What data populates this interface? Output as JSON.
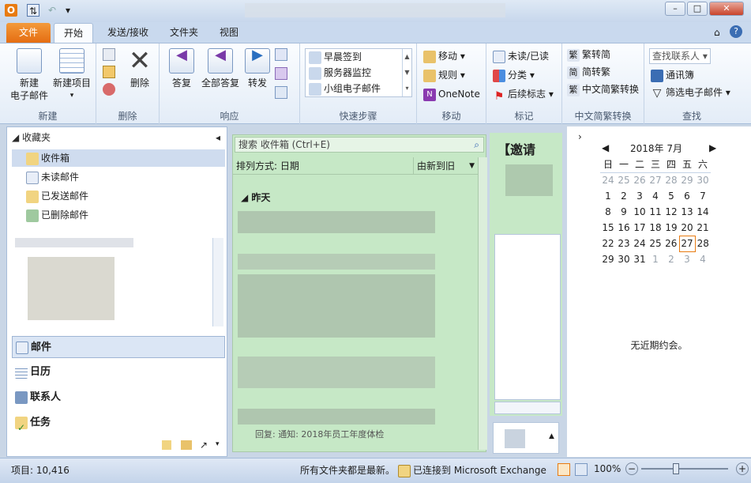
{
  "titlebar": {
    "minimize": "–",
    "maximize": "□",
    "close": "✕"
  },
  "tabs": [
    "文件",
    "开始",
    "发送/接收",
    "文件夹",
    "视图"
  ],
  "ribbon": {
    "new": {
      "new_mail": "新建\n电子邮件",
      "new_items": "新建项目",
      "label": "新建"
    },
    "delete": {
      "delete": "删除",
      "label": "删除"
    },
    "respond": {
      "reply": "答复",
      "reply_all": "全部答复",
      "forward": "转发",
      "label": "响应"
    },
    "quicksteps": {
      "items": [
        "早晨签到",
        "服务器监控",
        "小组电子邮件"
      ],
      "label": "快速步骤"
    },
    "move": {
      "move": "移动",
      "rules": "规则",
      "onenote": "OneNote",
      "label": "移动"
    },
    "tags": {
      "unread": "未读/已读",
      "categorize": "分类",
      "followup": "后续标志",
      "label": "标记"
    },
    "convert": {
      "t2s": "繁转简",
      "s2t": "简转繁",
      "convert": "中文简繁转换",
      "label": "中文简繁转换"
    },
    "find": {
      "find_contact": "查找联系人",
      "address_book": "通讯簿",
      "filter": "筛选电子邮件",
      "label": "查找"
    }
  },
  "nav": {
    "favorites": "收藏夹",
    "folders": [
      "收件箱",
      "未读邮件",
      "已发送邮件",
      "已删除邮件"
    ],
    "modules": [
      "邮件",
      "日历",
      "联系人",
      "任务"
    ]
  },
  "list": {
    "search_placeholder": "搜索 收件箱 (Ctrl+E)",
    "sort_by": "排列方式: 日期",
    "order": "由新到旧",
    "group": "昨天",
    "footer": "回复: 通知: 2018年员工年度体检"
  },
  "reading": {
    "subject": "【邀请"
  },
  "calendar": {
    "month": "2018年 7月",
    "weekdays": [
      "日",
      "一",
      "二",
      "三",
      "四",
      "五",
      "六"
    ],
    "weeks": [
      [
        "24",
        "25",
        "26",
        "27",
        "28",
        "29",
        "30"
      ],
      [
        "1",
        "2",
        "3",
        "4",
        "5",
        "6",
        "7"
      ],
      [
        "8",
        "9",
        "10",
        "11",
        "12",
        "13",
        "14"
      ],
      [
        "15",
        "16",
        "17",
        "18",
        "19",
        "20",
        "21"
      ],
      [
        "22",
        "23",
        "24",
        "25",
        "26",
        "27",
        "28"
      ],
      [
        "29",
        "30",
        "31",
        "1",
        "2",
        "3",
        "4"
      ]
    ],
    "today": "27",
    "no_appointments": "无近期约会。"
  },
  "status": {
    "items": "项目: 10,416",
    "folders_updated": "所有文件夹都是最新。",
    "exchange": "已连接到 Microsoft Exchange",
    "zoom": "100%"
  }
}
